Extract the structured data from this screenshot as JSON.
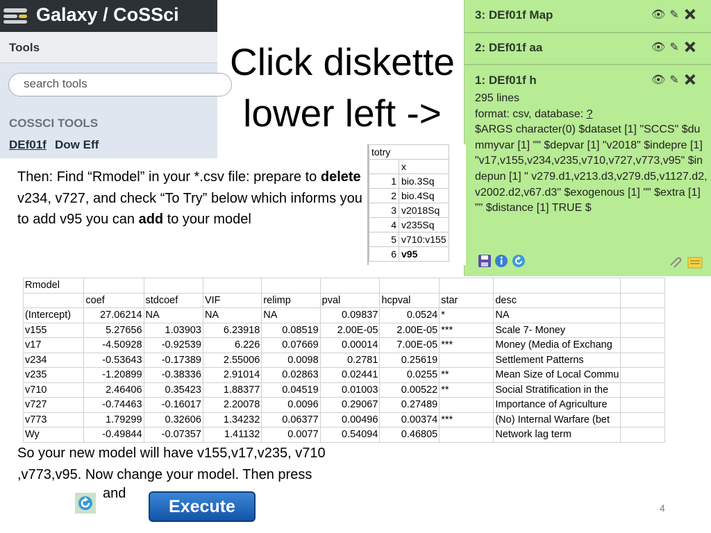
{
  "galaxy": {
    "title": "Galaxy / CoSSci",
    "tools_label": "Tools",
    "search_placeholder": "search tools",
    "section_label": "COSSCI TOOLS",
    "tool_link": "DEf01f",
    "tool_desc": "Dow Eff"
  },
  "slide": {
    "title_line1": "Click diskette",
    "title_line2": "lower left ->",
    "page_number": "4"
  },
  "history": {
    "items": [
      {
        "title": "3: DEf01f Map"
      },
      {
        "title": "2: DEf01f aa"
      },
      {
        "title": "1: DEf01f h"
      }
    ],
    "lines": "295 lines",
    "format_text": "format: csv, database: ",
    "format_link": "?",
    "args": "$ARGS character(0) $dataset [1] \"SCCS\" $dummyvar [1] \"\" $depvar [1] \"v2018\" $indepre [1] \"v17,v155,v234,v235,v710,v727,v773,v95\" $indepun [1] \" v279.d1,v213.d3,v279.d5,v1127.d2,v2002.d2,v67.d3\" $exogenous [1] \"\" $extra [1] \"\" $distance [1] TRUE $"
  },
  "totry": {
    "header": "totry",
    "col": "x",
    "rows": [
      {
        "n": "1",
        "v": "bio.3Sq"
      },
      {
        "n": "2",
        "v": "bio.4Sq"
      },
      {
        "n": "3",
        "v": "v2018Sq"
      },
      {
        "n": "4",
        "v": "v235Sq"
      },
      {
        "n": "5",
        "v": "v710:v155"
      },
      {
        "n": "6",
        "v": "v95"
      }
    ]
  },
  "instructions": {
    "p1": "Then: Find “Rmodel” in your *.csv file: prepare to ",
    "delete": "delete",
    "p2": " v234, v727, and check “To Try” below which informs you to add v95 you can ",
    "add": "add",
    "p3": " to your model"
  },
  "rmodel": {
    "title": "Rmodel",
    "headers": [
      "",
      "coef",
      "stdcoef",
      "VIF",
      "relimp",
      "pval",
      "hcpval",
      "star",
      "desc"
    ],
    "rows": [
      [
        "(Intercept)",
        "27.06214",
        "NA",
        "NA",
        "NA",
        "0.09837",
        "0.0524",
        "*",
        "NA"
      ],
      [
        "v155",
        "5.27656",
        "1.03903",
        "6.23918",
        "0.08519",
        "2.00E-05",
        "2.00E-05",
        "***",
        "Scale 7- Money"
      ],
      [
        "v17",
        "-4.50928",
        "-0.92539",
        "6.226",
        "0.07669",
        "0.00014",
        "7.00E-05",
        "***",
        "Money (Media of Exchang"
      ],
      [
        "v234",
        "-0.53643",
        "-0.17389",
        "2.55006",
        "0.0098",
        "0.2781",
        "0.25619",
        "",
        "Settlement Patterns"
      ],
      [
        "v235",
        "-1.20899",
        "-0.38336",
        "2.91014",
        "0.02863",
        "0.02441",
        "0.0255",
        "**",
        "Mean Size of Local Commu"
      ],
      [
        "v710",
        "2.46406",
        "0.35423",
        "1.88377",
        "0.04519",
        "0.01003",
        "0.00522",
        "**",
        "Social Stratification in the"
      ],
      [
        "v727",
        "-0.74463",
        "-0.16017",
        "2.20078",
        "0.0096",
        "0.29067",
        "0.27489",
        "",
        "Importance of Agriculture"
      ],
      [
        "v773",
        "1.79299",
        "0.32606",
        "1.34232",
        "0.06377",
        "0.00496",
        "0.00374",
        "***",
        "(No) Internal Warfare (bet"
      ],
      [
        "Wy",
        "-0.49844",
        "-0.07357",
        "1.41132",
        "0.0077",
        "0.54094",
        "0.46805",
        "",
        "Network lag term"
      ]
    ]
  },
  "bottom": {
    "text": "So your new model will have v155,v17,v235, v710 ,v773,v95. Now change your model. Then press",
    "and": "and",
    "execute": "Execute"
  },
  "colors": {
    "history_bg": "#b7eb94",
    "galaxy_header": "#2c3135",
    "execute_blue": "#1f66c2"
  }
}
